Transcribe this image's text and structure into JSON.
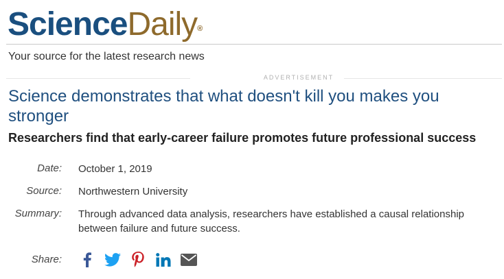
{
  "logo": {
    "part1": "Science",
    "part2": "Daily",
    "mark": "®"
  },
  "tagline": "Your source for the latest research news",
  "ad_label": "ADVERTISEMENT",
  "article": {
    "headline": "Science demonstrates that what doesn't kill you makes you stronger",
    "subhead": "Researchers find that early-career failure promotes future professional success",
    "date_label": "Date:",
    "date": "October 1, 2019",
    "source_label": "Source:",
    "source": "Northwestern University",
    "summary_label": "Summary:",
    "summary": "Through advanced data analysis, researchers have established a causal relationship between failure and future success."
  },
  "share": {
    "label": "Share:",
    "icons": [
      "facebook-icon",
      "twitter-icon",
      "pinterest-icon",
      "linkedin-icon",
      "email-icon"
    ]
  },
  "colors": {
    "brand_blue": "#1a4f7f",
    "brand_gold": "#8e6a2c",
    "facebook": "#3b5998",
    "twitter": "#1da1f2",
    "pinterest": "#cb2027",
    "linkedin": "#0077b5",
    "email": "#555555"
  }
}
